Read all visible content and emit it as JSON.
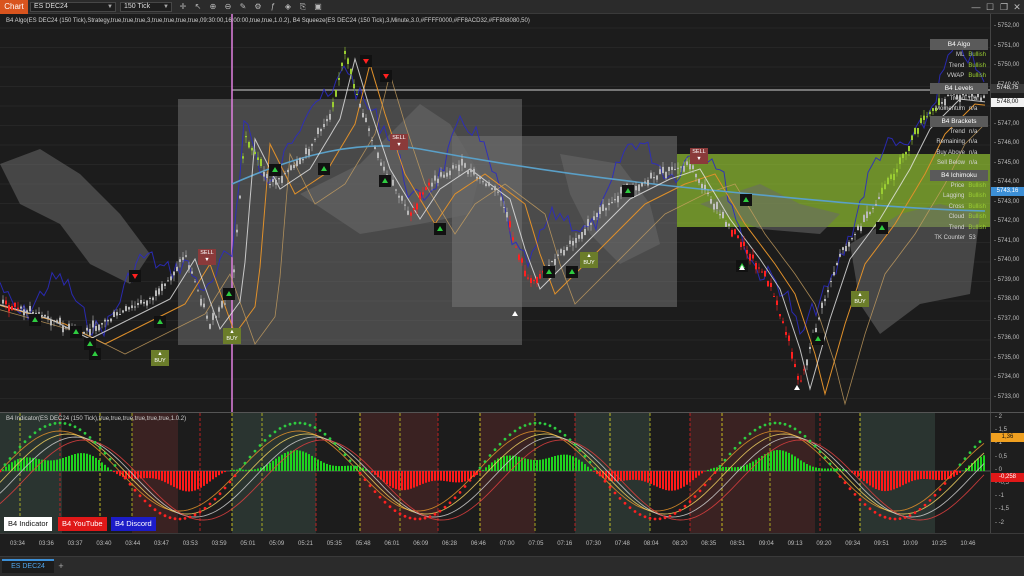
{
  "toolbar": {
    "chart_label": "Chart",
    "instrument": "ES DEC24",
    "bar_type": "150 Tick"
  },
  "price_panel": {
    "indicator_line": "B4 Algo(ES DEC24 (150 Tick),Strategy,true,true,true,3,true,true,true,true,09:30:00,16:00:00,true,true,1.0.2), B4 Squeeze(ES DEC24 (150 Tick),3,Minute,3.0,#FFFF0000,#FF8ACD32,#FF808080,50)",
    "price_ticks": [
      "5752,00",
      "5751,00",
      "5750,00",
      "5749,00",
      "5748,00",
      "5747,00",
      "5746,00",
      "5745,00",
      "5744,00",
      "5743,00",
      "5742,00",
      "5741,00",
      "5740,00",
      "5739,00",
      "5738,00",
      "5737,00",
      "5736,00",
      "5735,00",
      "5734,00",
      "5733,00"
    ],
    "price_tags": [
      {
        "text": "5748,75",
        "bg": "#3a3a3a",
        "fg": "#eeeeee"
      },
      {
        "text": "5748,00",
        "bg": "#f2f2f2",
        "fg": "#111111"
      },
      {
        "text": "5743,16",
        "bg": "#3c8fd6",
        "fg": "#ffffff"
      }
    ]
  },
  "status": {
    "sections": [
      {
        "title": "B4 Algo",
        "rows": [
          {
            "k": "ML",
            "v": "Bullish",
            "color": "#9acd32"
          },
          {
            "k": "Trend",
            "v": "Bullish",
            "color": "#9acd32"
          },
          {
            "k": "VWAP",
            "v": "Bullish",
            "color": "#9acd32"
          }
        ]
      },
      {
        "title": "B4 Levels",
        "rows": [
          {
            "k": "Trend",
            "v": "n/a",
            "color": "#d4d4d4"
          },
          {
            "k": "Momentum",
            "v": "n/a",
            "color": "#d4d4d4"
          }
        ]
      },
      {
        "title": "B4 Brackets",
        "rows": [
          {
            "k": "Trend",
            "v": "n/a",
            "color": "#d4d4d4"
          },
          {
            "k": "Remaining",
            "v": "n/a",
            "color": "#d4d4d4"
          },
          {
            "k": "Buy Above",
            "v": "n/a",
            "color": "#d4d4d4"
          },
          {
            "k": "Sell Below",
            "v": "n/a",
            "color": "#d4d4d4"
          }
        ]
      },
      {
        "title": "B4 Ichimoku",
        "rows": [
          {
            "k": "Price",
            "v": "Bullish",
            "color": "#9acd32"
          },
          {
            "k": "Lagging",
            "v": "Bullish",
            "color": "#9acd32"
          },
          {
            "k": "Cross",
            "v": "Bullish",
            "color": "#9acd32"
          },
          {
            "k": "Cloud",
            "v": "Bullish",
            "color": "#9acd32"
          },
          {
            "k": "Trend",
            "v": "Bullish",
            "color": "#9acd32"
          },
          {
            "k": "TK Counter",
            "v": "53",
            "color": "#d4d4d4"
          }
        ]
      }
    ]
  },
  "signals": {
    "buy": "BUY",
    "sell": "SELL"
  },
  "indicator_panel": {
    "indicator_line": "B4 Indicator(ES DEC24 (150 Tick),true,true,true,true,true,true,1.0.2)",
    "ticks": [
      "2",
      "1,5",
      "1",
      "0,5",
      "0",
      "-0,5",
      "-1",
      "-1,5",
      "-2"
    ],
    "tags": [
      {
        "text": "1,36",
        "bg": "#f0a020",
        "fg": "#111111"
      },
      {
        "text": "-0,258",
        "bg": "#e01818",
        "fg": "#ffffff"
      }
    ],
    "legend": [
      {
        "label": "B4 Indicator",
        "bg": "#ffffff",
        "fg": "#111111"
      },
      {
        "label": "B4 YouTube",
        "bg": "#e01818",
        "fg": "#ffffff"
      },
      {
        "label": "B4 Discord",
        "bg": "#1c1cc8",
        "fg": "#ffffff"
      }
    ]
  },
  "time_axis": [
    "03:34",
    "03:36",
    "03:37",
    "03:40",
    "03:44",
    "03:47",
    "03:53",
    "03:59",
    "05:01",
    "05:09",
    "05:21",
    "05:35",
    "05:48",
    "06:01",
    "06:09",
    "06:28",
    "06:46",
    "07:00",
    "07:05",
    "07:16",
    "07:30",
    "07:48",
    "08:04",
    "08:20",
    "08:35",
    "08:51",
    "09:04",
    "09:13",
    "09:20",
    "09:34",
    "09:51",
    "10:09",
    "10:25",
    "10:46"
  ],
  "tabs": {
    "active": "ES DEC24",
    "add_symbol": "+"
  },
  "colors": {
    "bull": "#9acd32",
    "bear": "#ff2020",
    "neutral_bar": "#b8b8b8",
    "cloud": "#6a6a6a",
    "vwap": "#5aa0c8",
    "orange_line": "#e0902a",
    "blue_line": "#2b2bc0"
  }
}
